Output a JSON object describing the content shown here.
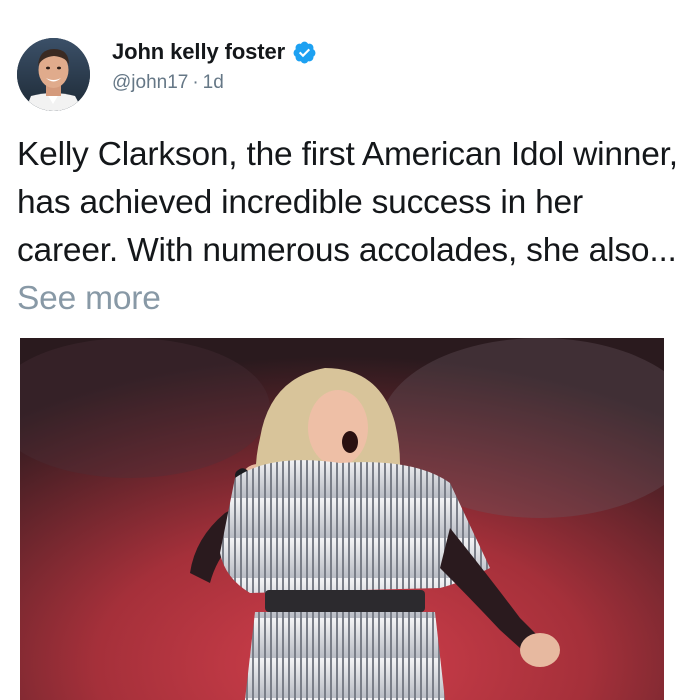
{
  "post": {
    "author": {
      "display_name": "John kelly foster",
      "handle": "@john17",
      "verified": true,
      "verified_icon": "verified-badge-icon",
      "avatar_icon": "profile-photo"
    },
    "separator": "·",
    "timestamp": "1d",
    "text": "Kelly Clarkson, the first American Idol winner, has achieved incredible success in her career. With numerous accolades, she also...",
    "see_more_label": "See more",
    "media": {
      "type": "photo",
      "subject": "singer performing on stage with microphone in silver fringe outfit"
    }
  },
  "colors": {
    "text": "#14171a",
    "secondary_text": "#657786",
    "see_more": "#8899a6",
    "verified_badge": "#1da1f2",
    "stage_red": "#c8323e"
  }
}
